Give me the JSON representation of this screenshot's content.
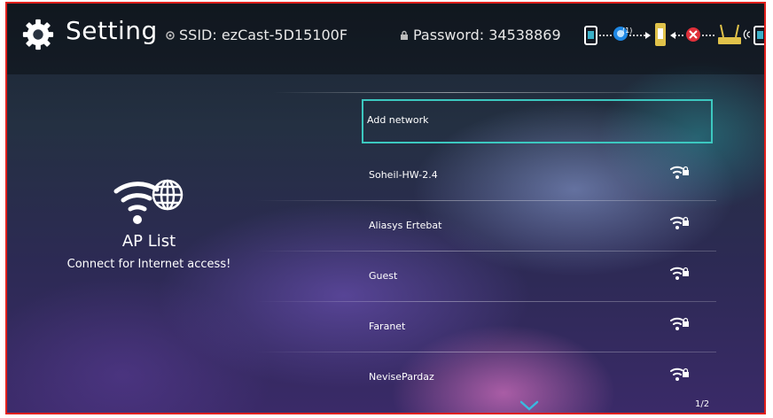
{
  "header": {
    "title": "Setting",
    "ssid": "SSID: ezCast-5D15100F",
    "password": "Password: 34538869",
    "status_count": "(1)"
  },
  "left_panel": {
    "title": "AP List",
    "subtitle": "Connect for Internet access!"
  },
  "networks": [
    {
      "label": "Add network",
      "selected": true,
      "secured": false
    },
    {
      "label": "Soheil-HW-2.4",
      "secured": true
    },
    {
      "label": "Aliasys Ertebat",
      "secured": true
    },
    {
      "label": "Guest",
      "secured": true
    },
    {
      "label": "Faranet",
      "secured": true
    },
    {
      "label": "NevisePardaz",
      "secured": true
    }
  ],
  "pagination": "1/2",
  "colors": {
    "accent": "#3cc8c0",
    "border": "#e0201c",
    "error": "#e0303a"
  },
  "icons": [
    "gear-icon",
    "ssid-icon",
    "lock-icon",
    "wifi-globe-icon",
    "wifi-lock-icon",
    "chevron-down-icon"
  ]
}
